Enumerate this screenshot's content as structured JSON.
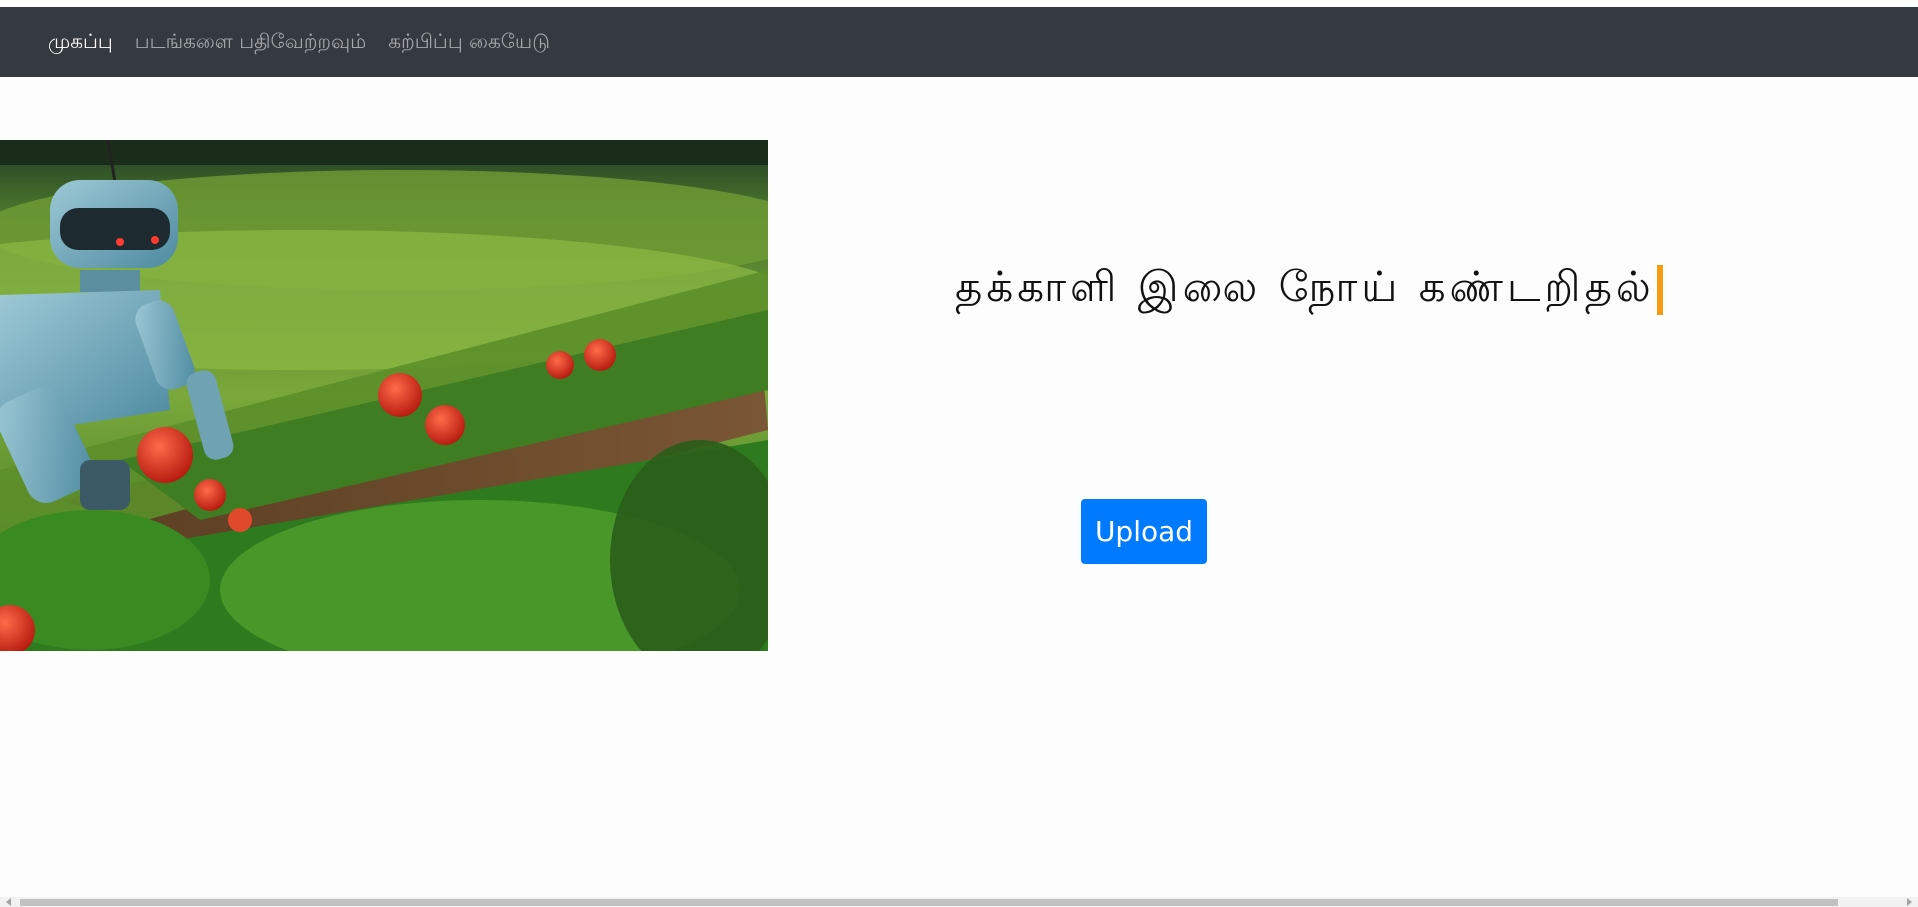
{
  "nav": {
    "items": [
      {
        "label": "முகப்பு",
        "active": true
      },
      {
        "label": "படங்களை பதிவேற்றவும்",
        "active": false
      },
      {
        "label": "கற்பிப்பு கையேடு",
        "active": false
      }
    ]
  },
  "hero": {
    "image": "robot-in-tomato-field"
  },
  "main": {
    "title": "தக்காளி இலை நோய் கண்டறிதல்",
    "upload_label": "Upload"
  },
  "colors": {
    "navbar_bg": "#343a40",
    "accent": "#007bff",
    "caret": "#f39c12"
  }
}
